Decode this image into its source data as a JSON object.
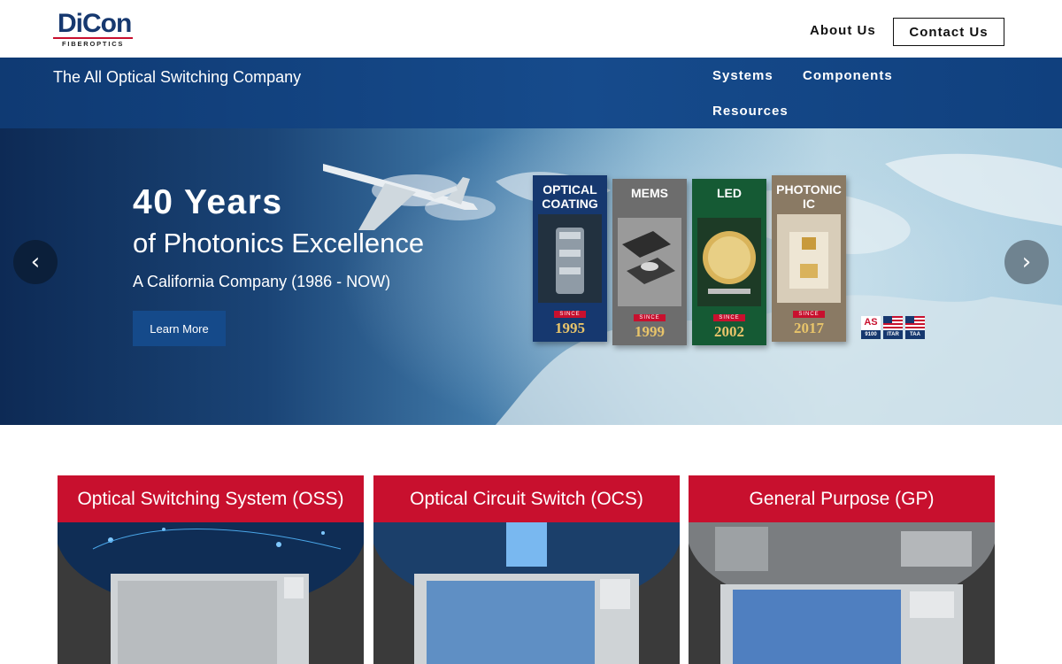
{
  "header": {
    "logo_main": "DiCon",
    "logo_sub": "FIBEROPTICS",
    "about_label": "About Us",
    "contact_label": "Contact Us"
  },
  "navband": {
    "tagline": "The All Optical Switching Company",
    "items": [
      {
        "label": "Systems"
      },
      {
        "label": "Components"
      },
      {
        "label": "Resources"
      }
    ]
  },
  "hero": {
    "title": "40 Years",
    "subtitle": "of Photonics Excellence",
    "tagline": "A California Company (1986 - NOW)",
    "button_label": "Learn More",
    "prev_label": "‹",
    "next_label": "›",
    "banners": [
      {
        "title": "OPTICAL COATING",
        "since": "SINCE",
        "year": "1995",
        "color": "#16386f"
      },
      {
        "title": "MEMS",
        "since": "SINCE",
        "year": "1999",
        "color": "#6d6d6d"
      },
      {
        "title": "LED",
        "since": "SINCE",
        "year": "2002",
        "color": "#155a34"
      },
      {
        "title": "PHOTONIC IC",
        "since": "SINCE",
        "year": "2017",
        "color": "#8a7a64"
      }
    ],
    "certs": [
      {
        "label": "9100",
        "mark": "AS"
      },
      {
        "label": "ITAR"
      },
      {
        "label": "TAA"
      }
    ]
  },
  "cards": [
    {
      "title": "Optical Switching System (OSS)"
    },
    {
      "title": "Optical Circuit Switch (OCS)"
    },
    {
      "title": "General Purpose (GP)"
    }
  ],
  "colors": {
    "brand_navy": "#16386f",
    "brand_red": "#c8102e",
    "nav_blue": "#164b8c"
  }
}
